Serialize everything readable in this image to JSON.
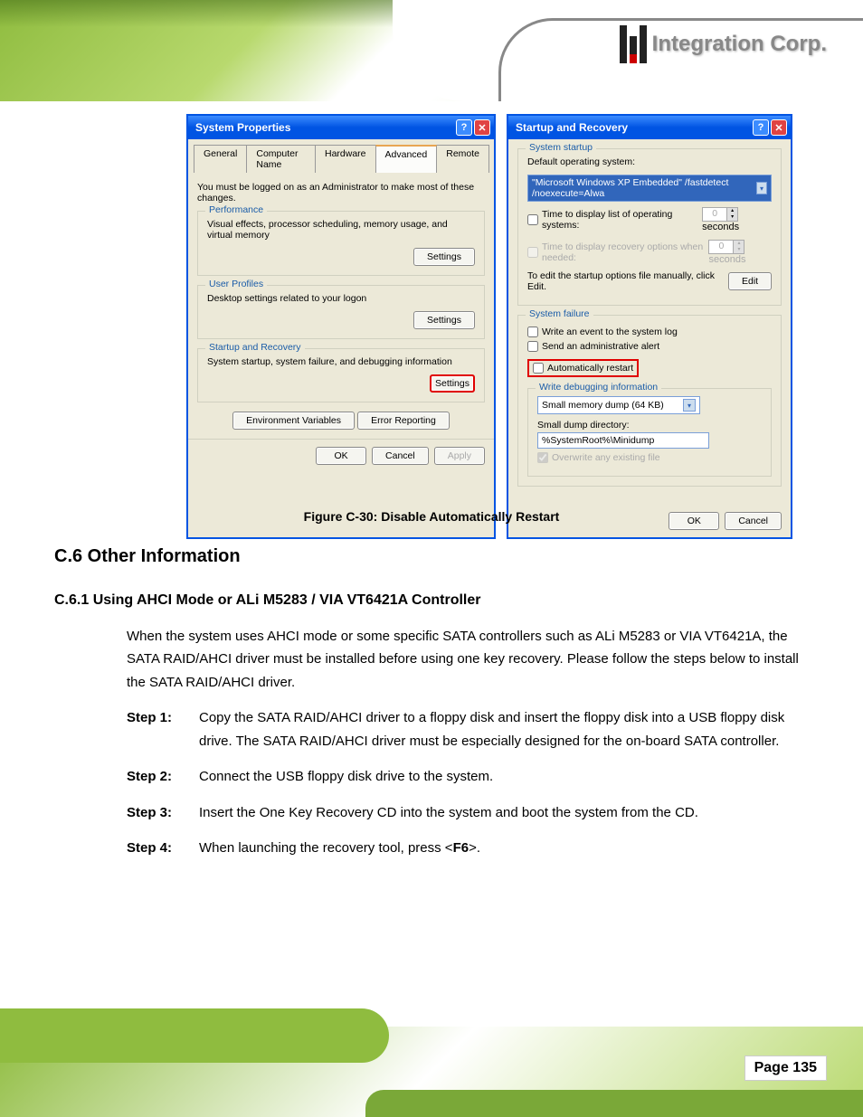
{
  "header": {
    "logo_text": "Integration Corp."
  },
  "dlg1": {
    "title": "System Properties",
    "tabs": [
      "General",
      "Computer Name",
      "Hardware",
      "Advanced",
      "Remote"
    ],
    "active_tab": "Advanced",
    "admin_note": "You must be logged on as an Administrator to make most of these changes.",
    "perf": {
      "legend": "Performance",
      "desc": "Visual effects, processor scheduling, memory usage, and virtual memory",
      "btn": "Settings"
    },
    "profiles": {
      "legend": "User Profiles",
      "desc": "Desktop settings related to your logon",
      "btn": "Settings"
    },
    "startup": {
      "legend": "Startup and Recovery",
      "desc": "System startup, system failure, and debugging information",
      "btn": "Settings"
    },
    "env_btn": "Environment Variables",
    "err_btn": "Error Reporting",
    "ok": "OK",
    "cancel": "Cancel",
    "apply": "Apply"
  },
  "dlg2": {
    "title": "Startup and Recovery",
    "sys_startup": {
      "legend": "System startup",
      "default_os_label": "Default operating system:",
      "default_os_value": "\"Microsoft Windows XP Embedded\" /fastdetect /noexecute=Alwa",
      "time_list": "Time to display list of operating systems:",
      "time_recovery": "Time to display recovery options when needed:",
      "seconds": "seconds",
      "spin_val": "0",
      "edit_note": "To edit the startup options file manually, click Edit.",
      "edit_btn": "Edit"
    },
    "sys_failure": {
      "legend": "System failure",
      "write_event": "Write an event to the system log",
      "send_alert": "Send an administrative alert",
      "auto_restart": "Automatically restart",
      "debug_legend": "Write debugging information",
      "dump_select": "Small memory dump (64 KB)",
      "dump_dir_label": "Small dump directory:",
      "dump_dir_value": "%SystemRoot%\\Minidump",
      "overwrite": "Overwrite any existing file"
    },
    "ok": "OK",
    "cancel": "Cancel"
  },
  "doc": {
    "caption": "Figure C-30: Disable Automatically Restart",
    "section_heading": "C.6 Other Information",
    "sub_heading": "C.6.1 Using AHCI Mode or ALi M5283 / VIA VT6421A Controller",
    "para1_a": "When the system uses AHCI mode or some specific SATA controllers such as ALi M5283 or VIA VT6421A, the SATA RAID/AHCI driver must be installed before using one key recovery. Please follow the steps below to install the SATA RAID/AHCI driver.",
    "step1_lbl": "Step 1:",
    "step1_txt": "Copy the SATA RAID/AHCI driver to a floppy disk and insert the floppy disk into a USB floppy disk drive. The SATA RAID/AHCI driver must be especially designed for the on-board SATA controller.",
    "step2_lbl": "Step 2:",
    "step2_txt": "Connect the USB floppy disk drive to the system.",
    "step3_lbl": "Step 3:",
    "step3_txt": "Insert the One Key Recovery CD into the system and boot the system from the CD.",
    "step4_lbl": "Step 4:",
    "step4_a": "When launching the recovery tool, press <",
    "step4_key": "F6",
    "step4_b": ">.",
    "page_num": "Page 135"
  }
}
